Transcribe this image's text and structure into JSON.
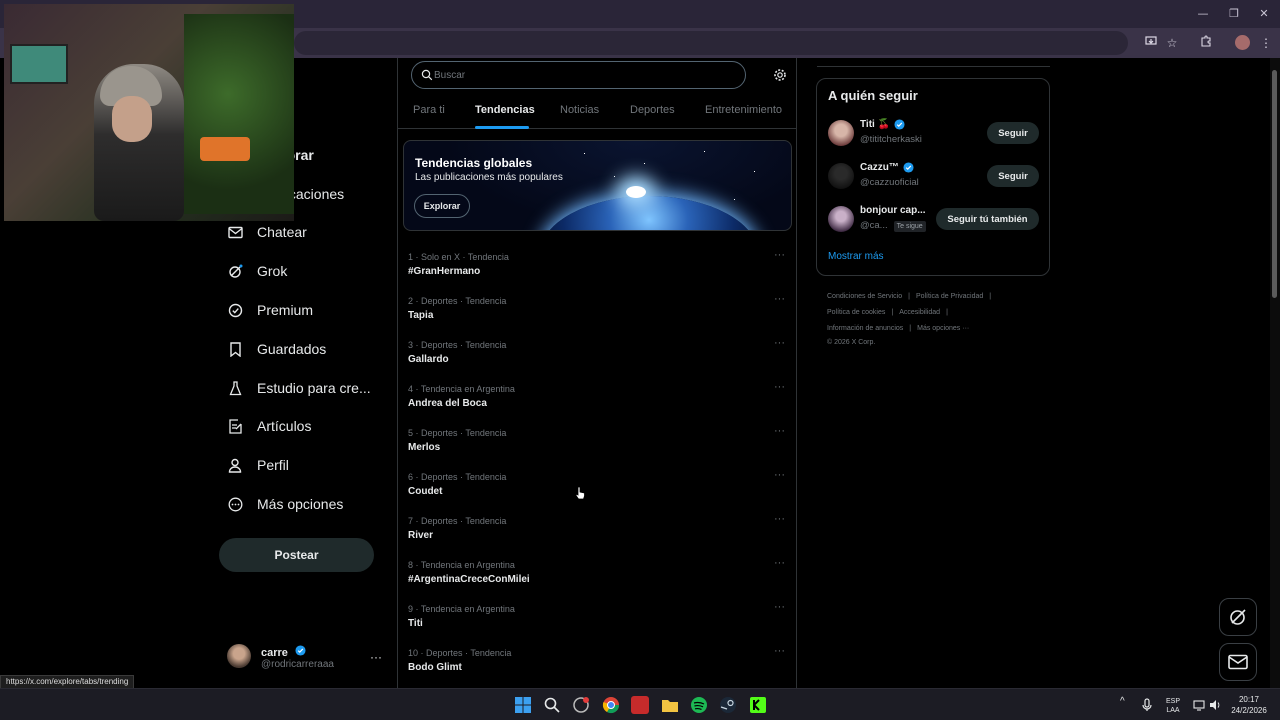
{
  "browser": {
    "window_controls": [
      "—",
      "❐",
      "✕"
    ]
  },
  "nav": {
    "items": [
      {
        "label": "Explorar",
        "icon": "search-icon",
        "name": "nav-item-explorar"
      },
      {
        "label": "Notificaciones",
        "icon": "bell-icon",
        "name": "nav-item-notificaciones"
      },
      {
        "label": "Chatear",
        "icon": "mail-icon",
        "name": "nav-item-chatear"
      },
      {
        "label": "Grok",
        "icon": "grok-icon",
        "name": "nav-item-grok"
      },
      {
        "label": "Premium",
        "icon": "verified-badge-icon",
        "name": "nav-item-premium"
      },
      {
        "label": "Guardados",
        "icon": "bookmark-icon",
        "name": "nav-item-guardados"
      },
      {
        "label": "Estudio para cre...",
        "icon": "flask-icon",
        "name": "nav-item-estudio"
      },
      {
        "label": "Artículos",
        "icon": "article-edit-icon",
        "name": "nav-item-articulos"
      },
      {
        "label": "Perfil",
        "icon": "person-icon",
        "name": "nav-item-perfil"
      },
      {
        "label": "Más opciones",
        "icon": "more-circle-icon",
        "name": "nav-item-mas-opciones"
      }
    ],
    "post_label": "Postear",
    "account": {
      "name": "carre",
      "handle": "@rodricarreraaa",
      "more": "···"
    }
  },
  "status_url": "https://x.com/explore/tabs/trending",
  "search": {
    "placeholder": "Buscar"
  },
  "tabs": [
    {
      "label": "Para ti",
      "active": false
    },
    {
      "label": "Tendencias",
      "active": true
    },
    {
      "label": "Noticias",
      "active": false
    },
    {
      "label": "Deportes",
      "active": false
    },
    {
      "label": "Entretenimiento",
      "active": false
    }
  ],
  "banner": {
    "title": "Tendencias globales",
    "subtitle": "Las publicaciones más populares",
    "button": "Explorar"
  },
  "trends": [
    {
      "meta": "1 · Solo en X · Tendencia",
      "name": "#GranHermano"
    },
    {
      "meta": "2 · Deportes · Tendencia",
      "name": "Tapia"
    },
    {
      "meta": "3 · Deportes · Tendencia",
      "name": "Gallardo"
    },
    {
      "meta": "4 · Tendencia en Argentina",
      "name": "Andrea del Boca"
    },
    {
      "meta": "5 · Deportes · Tendencia",
      "name": "Merlos"
    },
    {
      "meta": "6 · Deportes · Tendencia",
      "name": "Coudet"
    },
    {
      "meta": "7 · Deportes · Tendencia",
      "name": "River"
    },
    {
      "meta": "8 · Tendencia en Argentina",
      "name": "#ArgentinaCreceConMilei"
    },
    {
      "meta": "9 · Tendencia en Argentina",
      "name": "Titi"
    },
    {
      "meta": "10 · Deportes · Tendencia",
      "name": "Bodo Glimt"
    }
  ],
  "trend_more": "···",
  "who_to_follow": {
    "title": "A quién seguir",
    "accounts": [
      {
        "name": "Titi 🍒",
        "handle": "@tititcherkaski",
        "button": "Seguir",
        "verified": true,
        "follows_you": ""
      },
      {
        "name": "Cazzu™",
        "handle": "@cazzuoficial",
        "button": "Seguir",
        "verified": true,
        "follows_you": ""
      },
      {
        "name": "bonjour cap...",
        "handle": "@ca...",
        "button": "Seguir tú también",
        "verified": false,
        "follows_you": "Te sigue"
      }
    ],
    "show_more": "Mostrar más"
  },
  "footer": {
    "links": [
      "Condiciones de Servicio",
      "Política de Privacidad",
      "Política de cookies",
      "Accesibilidad",
      "Información de anuncios",
      "Más opciones ···"
    ],
    "copyright": "© 2026 X Corp."
  },
  "taskbar": {
    "lang_top": "ESP",
    "lang_bottom": "LAA",
    "time": "20:17",
    "date": "24/2/2026"
  },
  "colors": {
    "accent": "#1d9bf0",
    "background": "#000000",
    "text": "#e7e9ea",
    "muted": "#71767b",
    "border": "#2f3336"
  }
}
